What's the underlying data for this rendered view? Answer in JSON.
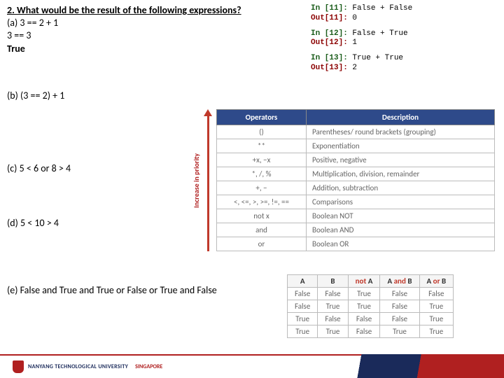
{
  "question": {
    "title": "2. What would be the result of the following expressions?",
    "a1": "(a)  3 == 2 + 1",
    "a2": "3 == 3",
    "a3": "True",
    "b": "(b) (3 == 2) + 1",
    "c": "(c) 5 < 6 or 8 > 4",
    "d": "(d) 5 < 10 > 4",
    "e": "(e) False and True and True or False or True and False"
  },
  "code": {
    "in11_lbl": "In [11]:",
    "in11": " False + False",
    "out11_lbl": "Out[11]:",
    "out11": " 0",
    "in12_lbl": "In [12]:",
    "in12": " False + True",
    "out12_lbl": "Out[12]:",
    "out12": " 1",
    "in13_lbl": "In [13]:",
    "in13": " True + True",
    "out13_lbl": "Out[13]:",
    "out13": " 2"
  },
  "prio": {
    "label": "Increase in priority",
    "h_ops": "Operators",
    "h_desc": "Description",
    "rows": [
      {
        "op": "()",
        "desc": "Parentheses/ round brackets (grouping)"
      },
      {
        "op": "**",
        "desc": "Exponentiation"
      },
      {
        "op": "+x, −x",
        "desc": "Positive, negative"
      },
      {
        "op": "*, /, %",
        "desc": "Multiplication, division, remainder"
      },
      {
        "op": "+, −",
        "desc": "Addition, subtraction"
      },
      {
        "op": "<, <=, >, >=, !=, ==",
        "desc": "Comparisons"
      },
      {
        "op": "not x",
        "desc": "Boolean NOT"
      },
      {
        "op": "and",
        "desc": "Boolean AND"
      },
      {
        "op": "or",
        "desc": "Boolean OR"
      }
    ]
  },
  "truth": {
    "h_a": "A",
    "h_b": "B",
    "h_not_pre": "not",
    "h_not_a": " A",
    "h_and_a": "A ",
    "h_and_mid": "and",
    "h_and_b": " B",
    "h_or_a": "A ",
    "h_or_mid": "or",
    "h_or_b": " B",
    "rows": [
      {
        "a": "False",
        "b": "False",
        "na": "True",
        "aandb": "False",
        "aorb": "False"
      },
      {
        "a": "False",
        "b": "True",
        "na": "True",
        "aandb": "False",
        "aorb": "True"
      },
      {
        "a": "True",
        "b": "False",
        "na": "False",
        "aandb": "False",
        "aorb": "True"
      },
      {
        "a": "True",
        "b": "True",
        "na": "False",
        "aandb": "True",
        "aorb": "True"
      }
    ]
  },
  "footer": {
    "uni": "NANYANG TECHNOLOGICAL UNIVERSITY",
    "sg": "SINGAPORE"
  }
}
